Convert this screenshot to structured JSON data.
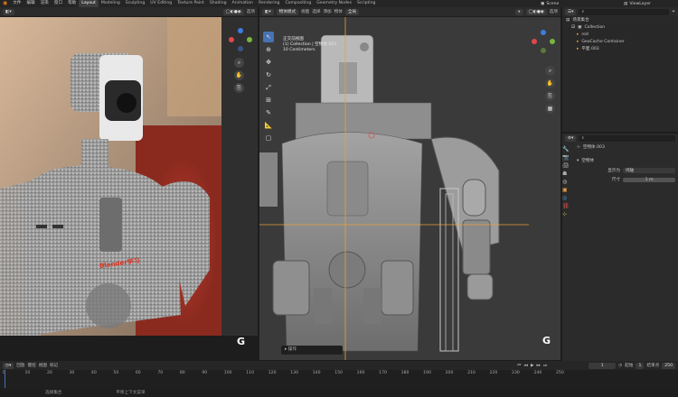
{
  "topbar": {
    "menus": [
      "文件",
      "编辑",
      "渲染",
      "窗口",
      "帮助"
    ],
    "workspaces": [
      "Layout",
      "Modeling",
      "Sculpting",
      "UV Editing",
      "Texture Paint",
      "Shading",
      "Animation",
      "Rendering",
      "Compositing",
      "Geometry Nodes",
      "Scripting"
    ],
    "active_workspace": "Layout",
    "scene_label": "Scene",
    "view_layer_label": "ViewLayer"
  },
  "left_viewport": {
    "view_label": "选项",
    "overlay_g": "G",
    "decal_text": "Blender学习"
  },
  "main_viewport": {
    "mode": "物体模式",
    "menus": [
      "视图",
      "选择",
      "添加",
      "物体"
    ],
    "transform": "全局",
    "info_line1": "正交前视图",
    "info_line2": "(1) Collection | 空物体.003",
    "info_line3": "10 Centimeters",
    "options_label": "选项",
    "overlay_g": "G",
    "search_placeholder": "▸ 操作"
  },
  "outliner": {
    "header": "场景集合",
    "items": [
      {
        "label": "Collection",
        "level": 1
      },
      {
        "label": "rod",
        "level": 2
      },
      {
        "label": "GeoCache Container",
        "level": 2
      },
      {
        "label": "平面.003",
        "level": 2
      }
    ]
  },
  "properties": {
    "object_name": "空物体.003",
    "panel_title": "空物体",
    "display_as_label": "显示为",
    "display_as_value": "纯轴",
    "size_label": "尺寸",
    "size_value": "1 m"
  },
  "timeline": {
    "menus": [
      "回放",
      "键控",
      "视图",
      "标记"
    ],
    "current_frame": "1",
    "start_label": "起始",
    "start_value": "1",
    "end_label": "结束点",
    "end_value": "250",
    "ruler": [
      "0",
      "10",
      "20",
      "30",
      "40",
      "50",
      "60",
      "70",
      "80",
      "90",
      "100",
      "110",
      "120",
      "130",
      "140",
      "150",
      "160",
      "170",
      "180",
      "190",
      "200",
      "210",
      "220",
      "230",
      "240",
      "250"
    ]
  },
  "statusbar": {
    "items": [
      "选择集合",
      "平移上下文菜单"
    ]
  },
  "colors": {
    "accent": "#4772b3",
    "selection_orange": "#e8a040",
    "axis_x": "#e0484b",
    "axis_y": "#7ab63e",
    "axis_z": "#3d7de0"
  }
}
